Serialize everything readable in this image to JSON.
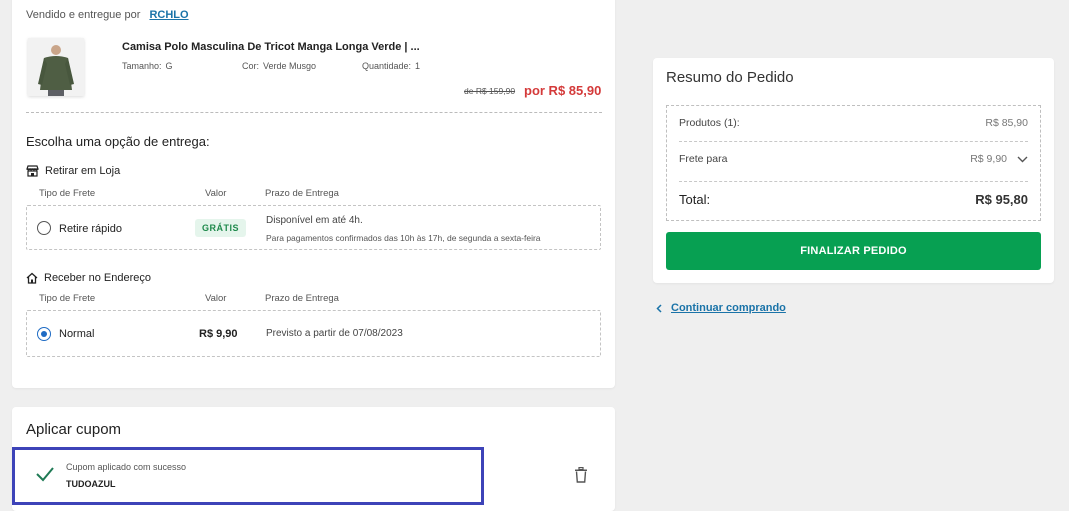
{
  "seller": {
    "prefix": "Vendido e entregue por",
    "name": "RCHLO"
  },
  "product": {
    "name": "Camisa Polo Masculina De Tricot Manga Longa Verde | ...",
    "size_label": "Tamanho:",
    "size": "G",
    "color_label": "Cor:",
    "color": "Verde Musgo",
    "qty_label": "Quantidade:",
    "qty": "1",
    "old_price": "de R$ 159,90",
    "price": "por R$ 85,90"
  },
  "delivery": {
    "title": "Escolha uma opção de entrega:",
    "pickup": {
      "heading": "Retirar em Loja",
      "col_type": "Tipo de Frete",
      "col_value": "Valor",
      "col_deadline": "Prazo de Entrega",
      "option_label": "Retire rápido",
      "badge": "GRÁTIS",
      "deadline": "Disponível em até 4h.",
      "note": "Para pagamentos confirmados das 10h às 17h, de segunda a sexta-feira"
    },
    "home": {
      "heading": "Receber no Endereço",
      "col_type": "Tipo de Frete",
      "col_value": "Valor",
      "col_deadline": "Prazo de Entrega",
      "option_label": "Normal",
      "value": "R$ 9,90",
      "deadline": "Previsto a partir de 07/08/2023"
    }
  },
  "coupon": {
    "title": "Aplicar cupom",
    "message": "Cupom aplicado com sucesso",
    "code": "TUDOAZUL"
  },
  "summary": {
    "title": "Resumo do Pedido",
    "products_label": "Produtos (1):",
    "products_value": "R$ 85,90",
    "shipping_label": "Frete para",
    "shipping_value": "R$ 9,90",
    "total_label": "Total:",
    "total_value": "R$ 95,80",
    "finish_button": "FINALIZAR PEDIDO"
  },
  "continue_link": "Continuar comprando",
  "colors": {
    "green": "#07a052",
    "price_red": "#d43a3a",
    "link_blue": "#1a73a8",
    "focus_border": "#3d43b8"
  }
}
